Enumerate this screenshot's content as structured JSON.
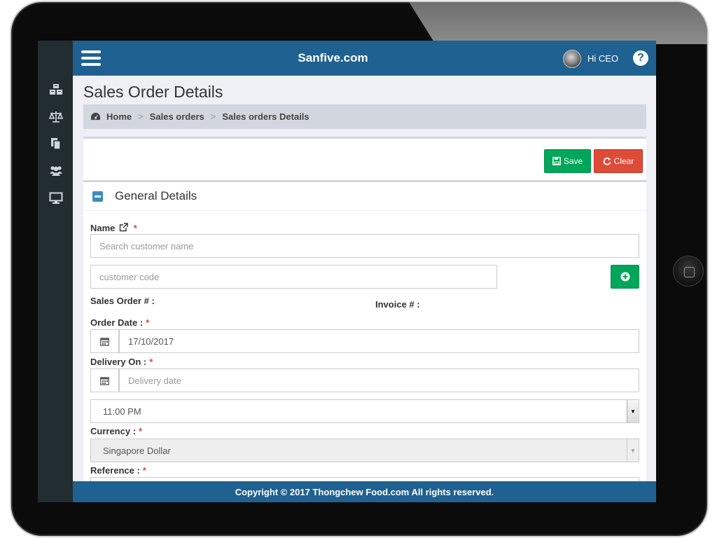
{
  "topbar": {
    "brand": "Sanfive.com",
    "greeting": "Hi CEO",
    "help": "?"
  },
  "page": {
    "title": "Sales Order Details"
  },
  "breadcrumb": {
    "home": "Home",
    "sales_orders": "Sales orders",
    "current": "Sales orders Details",
    "separator": ">"
  },
  "toolbar": {
    "save_label": "Save",
    "clear_label": "Clear"
  },
  "section": {
    "title": "General Details"
  },
  "form": {
    "name_label": "Name",
    "name_placeholder": "Search customer name",
    "code_placeholder": "customer code",
    "sales_order_label": "Sales Order # :",
    "invoice_label": "Invoice # :",
    "order_date_label": "Order Date :",
    "order_date_value": "17/10/2017",
    "delivery_on_label": "Delivery On :",
    "delivery_placeholder": "Delivery date",
    "delivery_time_value": "11:00 PM",
    "currency_label": "Currency :",
    "currency_value": "Singapore Dollar",
    "reference_label": "Reference :",
    "required_mark": "*"
  },
  "footer": {
    "text": "Copyright © 2017 Thongchew Food.com All rights reserved."
  },
  "sidebar": {
    "icons": [
      "cubes-icon",
      "balance-scale-icon",
      "copy-icon",
      "users-icon",
      "desktop-icon"
    ]
  },
  "colors": {
    "primary": "#1f6190",
    "sidebar": "#222d32",
    "success": "#00a65a",
    "danger": "#dd4b39",
    "section_icon": "#3c8dbc"
  }
}
